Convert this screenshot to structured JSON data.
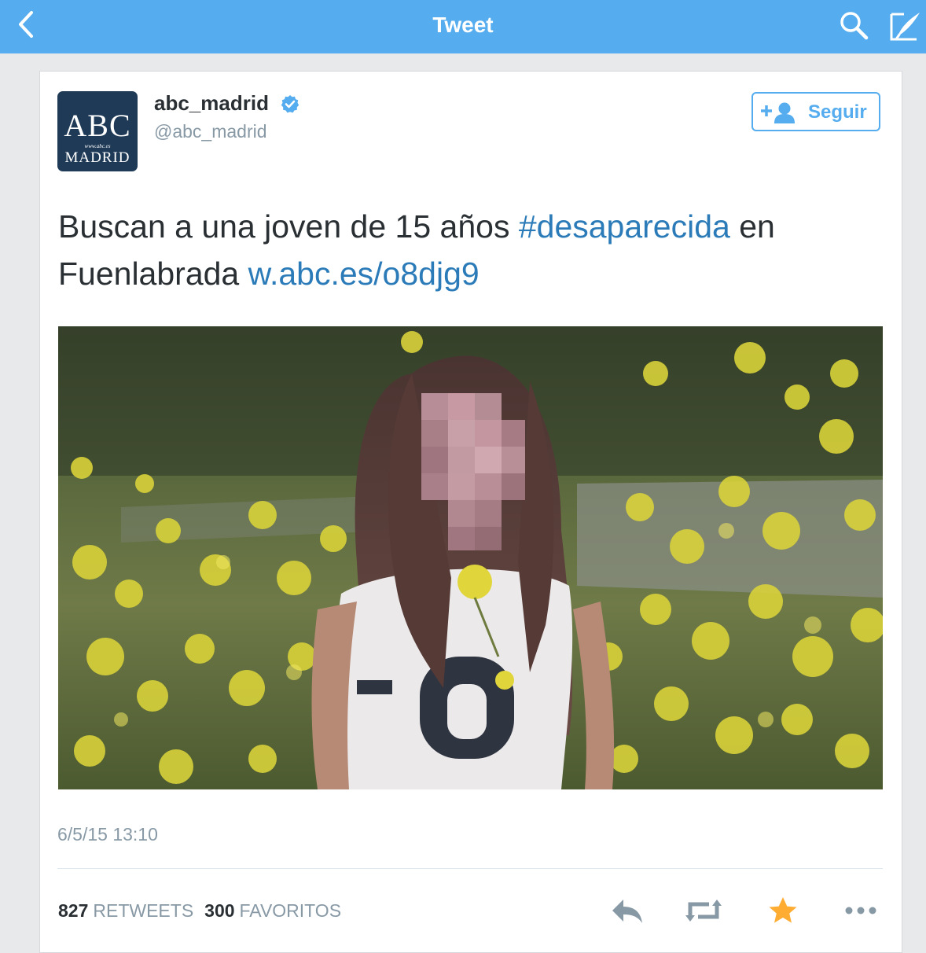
{
  "navbar": {
    "title": "Tweet",
    "background": "#55acee"
  },
  "tweet": {
    "author": {
      "name": "abc_madrid",
      "handle": "@abc_madrid",
      "verified": true,
      "avatar": {
        "logo_top": "ABC",
        "logo_url": "www.abc.es",
        "logo_bottom": "MADRID",
        "background": "#1f3a57"
      }
    },
    "follow_label": "Seguir",
    "text": {
      "part1": "Buscan a una joven de 15 años ",
      "hashtag": "#desaparecida",
      "part2": " en Fuenlabrada ",
      "link": "w.abc.es/o8djg9"
    },
    "photo_subject": "girl with pixelated face in field of yellow flowers",
    "timestamp": "6/5/15 13:10",
    "stats": {
      "retweets_count": "827",
      "retweets_label": "RETWEETS",
      "favorites_count": "300",
      "favorites_label": "FAVORITOS"
    },
    "actions": [
      "reply-icon",
      "retweet-icon",
      "favorite-star-icon",
      "more-icon"
    ],
    "colors": {
      "link": "#2b7bb9",
      "accent": "#55acee",
      "favorite": "#ffac33",
      "muted": "#8899a6"
    }
  }
}
